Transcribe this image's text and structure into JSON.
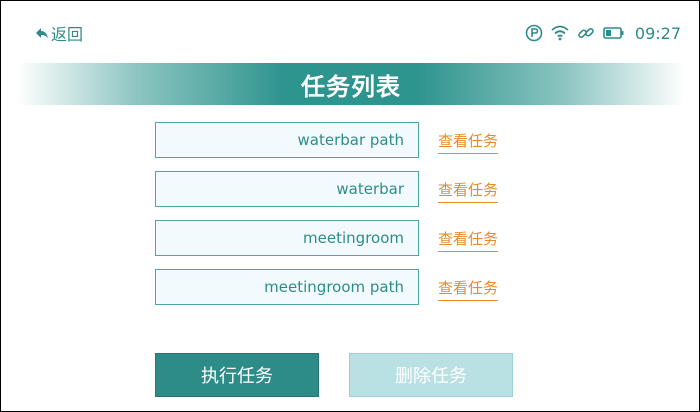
{
  "header": {
    "back_label": "返回",
    "time": "09:27"
  },
  "banner": {
    "title": "任务列表"
  },
  "tasks": [
    {
      "name": "waterbar path",
      "view_label": "查看任务"
    },
    {
      "name": "waterbar",
      "view_label": "查看任务"
    },
    {
      "name": "meetingroom",
      "view_label": "查看任务"
    },
    {
      "name": "meetingroom path",
      "view_label": "查看任务"
    }
  ],
  "actions": {
    "execute_label": "执行任务",
    "delete_label": "删除任务"
  },
  "icons": {
    "back": "back-arrow-icon",
    "parking": "parking-icon",
    "wifi": "wifi-icon",
    "link": "link-icon",
    "battery": "battery-icon"
  },
  "colors": {
    "accent": "#2e8c88",
    "link": "#e98a2a",
    "disabled_button": "#b9e0e3"
  }
}
